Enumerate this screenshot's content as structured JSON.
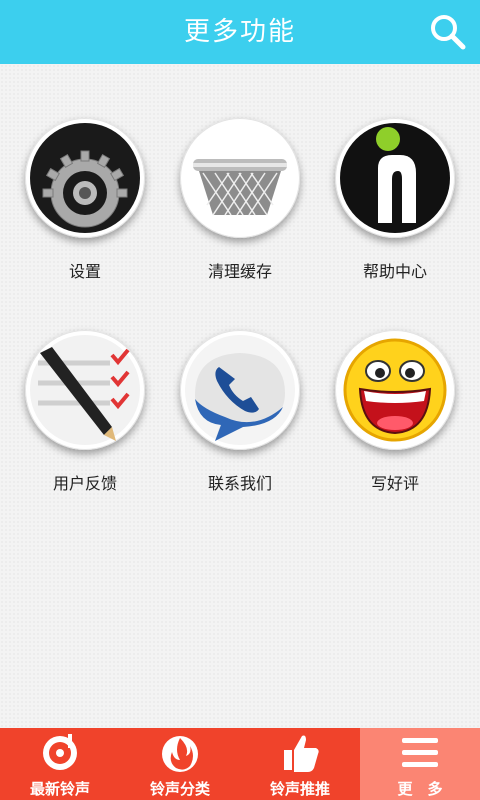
{
  "header": {
    "title": "更多功能",
    "search_icon": "search-icon"
  },
  "grid": [
    {
      "label": "设置",
      "icon": "gear-icon"
    },
    {
      "label": "清理缓存",
      "icon": "strainer-icon"
    },
    {
      "label": "帮助中心",
      "icon": "info-icon"
    },
    {
      "label": "用户反馈",
      "icon": "checklist-pencil-icon"
    },
    {
      "label": "联系我们",
      "icon": "phone-chat-icon"
    },
    {
      "label": "写好评",
      "icon": "smiley-icon"
    }
  ],
  "tabbar": {
    "active_index": 3,
    "tabs": [
      {
        "label": "最新铃声",
        "icon": "record-icon"
      },
      {
        "label": "铃声分类",
        "icon": "flame-icon"
      },
      {
        "label": "铃声推推",
        "icon": "thumbs-up-icon"
      },
      {
        "label": "更　多",
        "icon": "menu-icon"
      }
    ]
  },
  "colors": {
    "header": "#3ccfee",
    "tabbar": "#f0432b",
    "tab_active": "#fb8573"
  }
}
